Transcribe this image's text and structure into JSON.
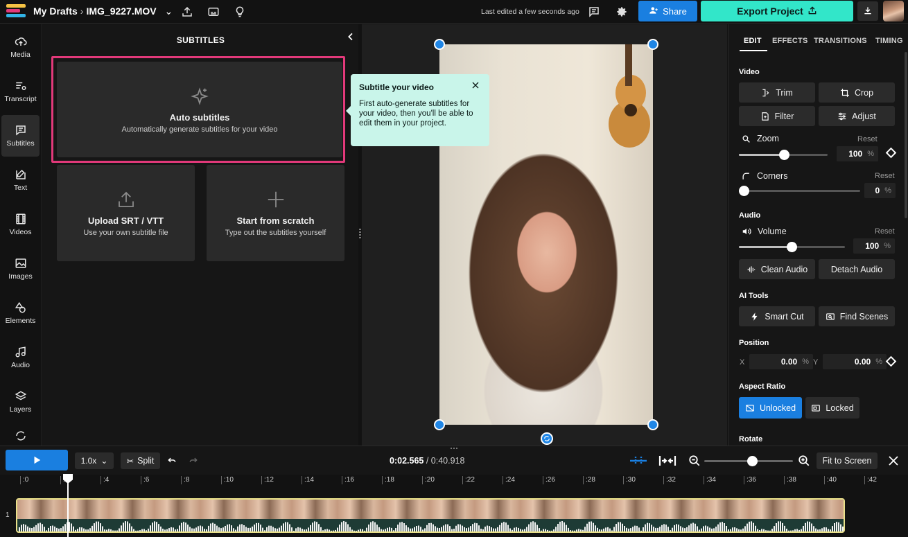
{
  "topbar": {
    "breadcrumb_root": "My Drafts",
    "file_name": "IMG_9227.MOV",
    "last_edited": "Last edited a few seconds ago",
    "share_label": "Share",
    "export_label": "Export Project"
  },
  "rail": {
    "items": [
      {
        "label": "Media",
        "icon": "upload-cloud-icon"
      },
      {
        "label": "Transcript",
        "icon": "transcript-icon"
      },
      {
        "label": "Subtitles",
        "icon": "subtitles-icon"
      },
      {
        "label": "Text",
        "icon": "text-edit-icon"
      },
      {
        "label": "Videos",
        "icon": "film-icon"
      },
      {
        "label": "Images",
        "icon": "image-icon"
      },
      {
        "label": "Elements",
        "icon": "shapes-icon"
      },
      {
        "label": "Audio",
        "icon": "music-note-icon"
      },
      {
        "label": "Layers",
        "icon": "layers-icon"
      }
    ]
  },
  "subtitles_panel": {
    "title": "SUBTITLES",
    "auto": {
      "title": "Auto subtitles",
      "subtitle": "Automatically generate subtitles for your video"
    },
    "upload": {
      "title": "Upload SRT / VTT",
      "subtitle": "Use your own subtitle file"
    },
    "scratch": {
      "title": "Start from scratch",
      "subtitle": "Type out the subtitles yourself"
    }
  },
  "tooltip": {
    "title": "Subtitle your video",
    "body": "First auto-generate subtitles for your video, then you'll be able to edit them in your project."
  },
  "right_panel": {
    "tabs": [
      "EDIT",
      "EFFECTS",
      "TRANSITIONS",
      "TIMING"
    ],
    "video_section": "Video",
    "trim": "Trim",
    "crop": "Crop",
    "filter": "Filter",
    "adjust": "Adjust",
    "zoom_label": "Zoom",
    "zoom_value": "100",
    "corners_label": "Corners",
    "corners_value": "0",
    "reset": "Reset",
    "audio_section": "Audio",
    "volume_label": "Volume",
    "volume_value": "100",
    "clean_audio": "Clean Audio",
    "detach_audio": "Detach Audio",
    "ai_section": "AI Tools",
    "smart_cut": "Smart Cut",
    "find_scenes": "Find Scenes",
    "position_section": "Position",
    "x_label": "X",
    "x_value": "0.00",
    "y_label": "Y",
    "y_value": "0.00",
    "percent": "%",
    "aspect_section": "Aspect Ratio",
    "unlocked": "Unlocked",
    "locked": "Locked",
    "rotate_section": "Rotate"
  },
  "timeline": {
    "speed": "1.0x",
    "split": "Split",
    "current_time": "0:02.565",
    "total_time": "/ 0:40.918",
    "fit_to_screen": "Fit to Screen",
    "track_number": "1",
    "ruler": [
      ":0",
      ":2",
      ":4",
      ":6",
      ":8",
      ":10",
      ":12",
      ":14",
      ":16",
      ":18",
      ":20",
      ":22",
      ":24",
      ":26",
      ":28",
      ":30",
      ":32",
      ":34",
      ":36",
      ":38",
      ":40",
      ":42"
    ]
  },
  "colors": {
    "accent_blue": "#1a7fe0",
    "export_teal": "#32e6c9",
    "highlight_pink": "#e2397a",
    "tooltip_bg": "#c9f5ea"
  }
}
